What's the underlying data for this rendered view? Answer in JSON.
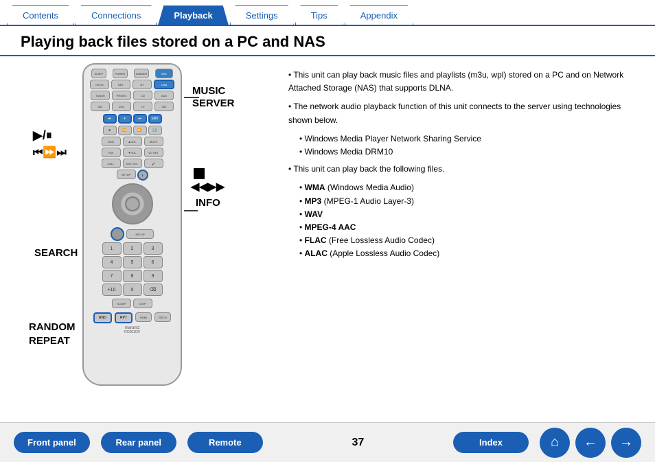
{
  "nav": {
    "tabs": [
      {
        "id": "contents",
        "label": "Contents",
        "active": false
      },
      {
        "id": "connections",
        "label": "Connections",
        "active": false
      },
      {
        "id": "playback",
        "label": "Playback",
        "active": true
      },
      {
        "id": "settings",
        "label": "Settings",
        "active": false
      },
      {
        "id": "tips",
        "label": "Tips",
        "active": false
      },
      {
        "id": "appendix",
        "label": "Appendix",
        "active": false
      }
    ]
  },
  "page": {
    "title": "Playing back files stored on a PC and NAS",
    "number": "37"
  },
  "labels": {
    "music_server": "MUSIC\nSERVER",
    "info": "INFO",
    "search": "SEARCH",
    "random": "RANDOM",
    "repeat": "REPEAT"
  },
  "content": {
    "bullets": [
      "This unit can play back music files and playlists (m3u, wpl) stored on a PC and on Network Attached Storage (NAS) that supports DLNA.",
      "The network audio playback function of this unit connects to the server using technologies shown below.",
      "Windows Media Player Network Sharing Service",
      "Windows Media DRM10",
      "This unit can play back the following files."
    ],
    "file_types": [
      {
        "bold": "WMA",
        "rest": " (Windows Media Audio)"
      },
      {
        "bold": "MP3",
        "rest": " (MPEG-1 Audio Layer-3)"
      },
      {
        "bold": "WAV",
        "rest": ""
      },
      {
        "bold": "MPEG-4 AAC",
        "rest": ""
      },
      {
        "bold": "FLAC",
        "rest": " (Free Lossless Audio Codec)"
      },
      {
        "bold": "ALAC",
        "rest": " (Apple Lossless Audio Codec)"
      }
    ]
  },
  "bottom": {
    "front_panel": "Front panel",
    "rear_panel": "Rear panel",
    "remote": "Remote",
    "index": "Index",
    "home_icon": "⌂",
    "back_icon": "←",
    "forward_icon": "→"
  }
}
